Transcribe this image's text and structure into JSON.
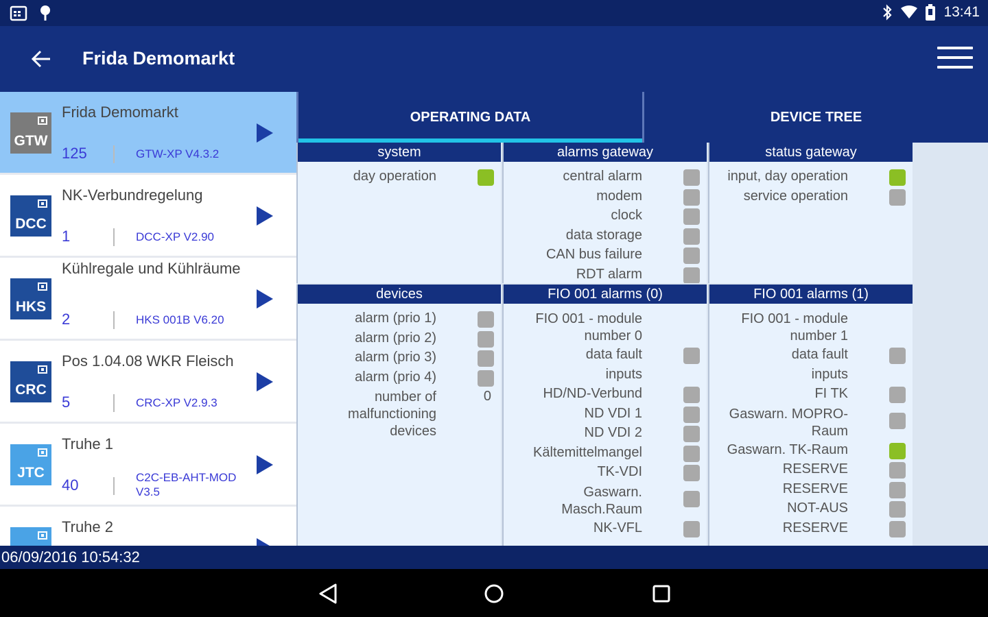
{
  "status_bar": {
    "time": "13:41"
  },
  "app_bar": {
    "title": "Frida Demomarkt"
  },
  "devices": [
    {
      "abbr": "GTW",
      "name": "Frida Demomarkt",
      "number": "125",
      "version": "GTW-XP   V4.3.2"
    },
    {
      "abbr": "DCC",
      "name": "NK-Verbundregelung",
      "number": "1",
      "version": "DCC-XP V2.90"
    },
    {
      "abbr": "HKS",
      "name": "Kühlregale und Kühlräume",
      "number": "2",
      "version": "HKS 001B V6.20"
    },
    {
      "abbr": "CRC",
      "name": "Pos 1.04.08 WKR Fleisch",
      "number": "5",
      "version": "CRC-XP V2.9.3"
    },
    {
      "abbr": "JTC",
      "name": "Truhe 1",
      "number": "40",
      "version": "C2C-EB-AHT-MOD V3.5"
    },
    {
      "abbr": "",
      "name": "Truhe 2",
      "number": "",
      "version": ""
    }
  ],
  "tabs": {
    "operating_data": "OPERATING DATA",
    "device_tree": "DEVICE TREE"
  },
  "panels": {
    "system": {
      "title": "system",
      "rows": [
        {
          "label": "day operation",
          "state": "green"
        }
      ]
    },
    "alarms_gateway": {
      "title": "alarms gateway",
      "rows": [
        {
          "label": "central alarm",
          "state": "gray"
        },
        {
          "label": "modem",
          "state": "gray"
        },
        {
          "label": "clock",
          "state": "gray"
        },
        {
          "label": "data storage",
          "state": "gray"
        },
        {
          "label": "CAN bus failure",
          "state": "gray"
        },
        {
          "label": "RDT alarm",
          "state": "gray"
        }
      ]
    },
    "status_gateway": {
      "title": "status gateway",
      "rows": [
        {
          "label": "input, day operation",
          "state": "green"
        },
        {
          "label": "service operation",
          "state": "gray"
        }
      ]
    },
    "devices": {
      "title": "devices",
      "rows": [
        {
          "label": "alarm (prio 1)",
          "state": "gray"
        },
        {
          "label": "alarm (prio 2)",
          "state": "gray"
        },
        {
          "label": "alarm (prio 3)",
          "state": "gray"
        },
        {
          "label": "alarm (prio 4)",
          "state": "gray"
        },
        {
          "label": "number of malfunctioning devices",
          "value": "0"
        }
      ]
    },
    "fio0": {
      "title": "FIO 001 alarms (0)",
      "rows": [
        {
          "label": "FIO 001 - module number 0"
        },
        {
          "label": "data fault",
          "state": "gray"
        },
        {
          "label": "inputs"
        },
        {
          "label": "HD/ND-Verbund",
          "state": "gray"
        },
        {
          "label": "ND VDI 1",
          "state": "gray"
        },
        {
          "label": "ND VDI 2",
          "state": "gray"
        },
        {
          "label": "Kältemittelmangel",
          "state": "gray"
        },
        {
          "label": "TK-VDI",
          "state": "gray"
        },
        {
          "label": "Gaswarn. Masch.Raum",
          "state": "gray"
        },
        {
          "label": "NK-VFL",
          "state": "gray"
        }
      ]
    },
    "fio1": {
      "title": "FIO 001 alarms (1)",
      "rows": [
        {
          "label": "FIO 001 - module number 1"
        },
        {
          "label": "data fault",
          "state": "gray"
        },
        {
          "label": "inputs"
        },
        {
          "label": "FI TK",
          "state": "gray"
        },
        {
          "label": "Gaswarn. MOPRO-Raum",
          "state": "gray"
        },
        {
          "label": "Gaswarn. TK-Raum",
          "state": "green"
        },
        {
          "label": "RESERVE",
          "state": "gray"
        },
        {
          "label": "RESERVE",
          "state": "gray"
        },
        {
          "label": "NOT-AUS",
          "state": "gray"
        },
        {
          "label": "RESERVE",
          "state": "gray"
        }
      ]
    }
  },
  "timestamp": "06/09/2016 10:54:32",
  "colors": {
    "primary": "#14307f",
    "selected": "#90c6f7",
    "accent": "#22c3e6",
    "ok": "#8bbf24",
    "inactive": "#a9a9a9"
  }
}
